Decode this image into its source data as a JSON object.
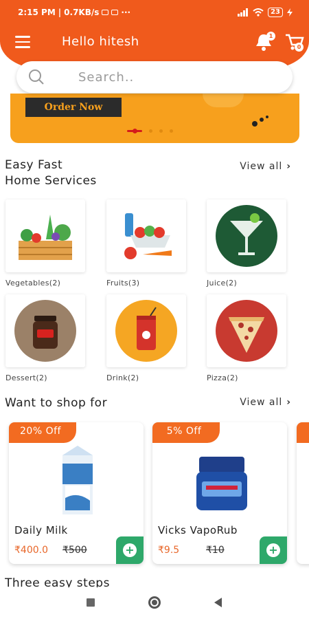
{
  "status_bar": {
    "time": "2:15 PM",
    "speed": "0.7KB/s",
    "battery": "23"
  },
  "header": {
    "greeting": "Hello hitesh",
    "notification_count": "1",
    "cart_count": "0"
  },
  "search": {
    "placeholder": "Search.."
  },
  "banner": {
    "button_label": "Order Now"
  },
  "section1": {
    "title_line1": "Easy Fast",
    "title_line2": "Home Services",
    "view_all": "View all"
  },
  "categories": [
    {
      "label": "Vegetables(2)",
      "icon": "vegetables-icon"
    },
    {
      "label": "Fruits(3)",
      "icon": "fruits-icon"
    },
    {
      "label": "Juice(2)",
      "icon": "juice-icon"
    },
    {
      "label": "Dessert(2)",
      "icon": "dessert-icon"
    },
    {
      "label": "Drink(2)",
      "icon": "drink-icon"
    },
    {
      "label": "Pizza(2)",
      "icon": "pizza-icon"
    }
  ],
  "section2": {
    "title": "Want to shop for",
    "view_all": "View all"
  },
  "products": [
    {
      "discount": "20% Off",
      "name": "Daily Milk",
      "price": "₹400.0",
      "old_price": "₹500"
    },
    {
      "discount": "5% Off",
      "name": "Vicks VapoRub",
      "price": "₹9.5",
      "old_price": "₹10"
    }
  ],
  "section3": {
    "title": "Three easy steps"
  },
  "colors": {
    "primary": "#f05a1c",
    "banner": "#f7a01d",
    "add": "#2ea86a",
    "price": "#e8672a"
  }
}
